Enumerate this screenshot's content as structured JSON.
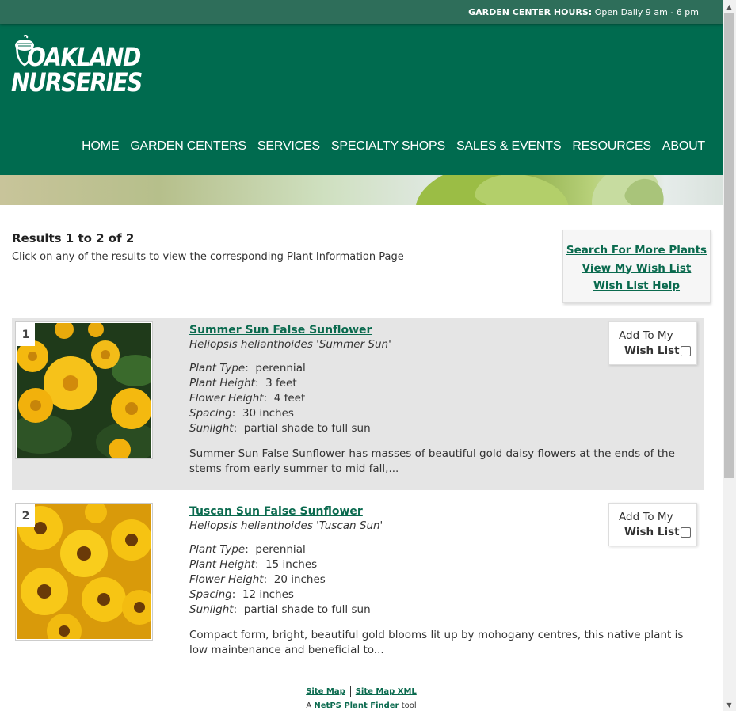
{
  "topbar": {
    "hours_label": "GARDEN CENTER HOURS:",
    "hours_value": "Open Daily 9 am - 6 pm"
  },
  "logo": {
    "line1": "OAKLAND",
    "line2": "NURSERIES"
  },
  "nav": [
    "HOME",
    "GARDEN CENTERS",
    "SERVICES",
    "SPECIALTY SHOPS",
    "SALES & EVENTS",
    "RESOURCES",
    "ABOUT"
  ],
  "results": {
    "title": "Results 1 to 2 of 2",
    "subtitle": "Click on any of the results to view the corresponding Plant Information Page"
  },
  "sidebox": {
    "links": [
      "Search For More Plants",
      "View My Wish List",
      "Wish List Help"
    ]
  },
  "items": [
    {
      "number": "1",
      "name": "Summer Sun False Sunflower",
      "latin": "Heliopsis helianthoides 'Summer Sun'",
      "plant_type_label": "Plant Type",
      "plant_type": "perennial",
      "plant_height_label": "Plant Height",
      "plant_height": "3 feet",
      "flower_height_label": "Flower Height",
      "flower_height": "4 feet",
      "spacing_label": "Spacing",
      "spacing": "30 inches",
      "sunlight_label": "Sunlight",
      "sunlight": "partial shade to full sun",
      "description": "Summer Sun False Sunflower has masses of beautiful gold daisy flowers at the ends of the stems from early summer to mid fall,...",
      "wish_line1": "Add To My",
      "wish_line2": "Wish List"
    },
    {
      "number": "2",
      "name": "Tuscan Sun False Sunflower",
      "latin": "Heliopsis helianthoides 'Tuscan Sun'",
      "plant_type_label": "Plant Type",
      "plant_type": "perennial",
      "plant_height_label": "Plant Height",
      "plant_height": "15 inches",
      "flower_height_label": "Flower Height",
      "flower_height": "20 inches",
      "spacing_label": "Spacing",
      "spacing": "12 inches",
      "sunlight_label": "Sunlight",
      "sunlight": "partial shade to full sun",
      "description": "Compact form, bright, beautiful gold blooms lit up by mohogany centres, this native plant is low maintenance and beneficial to...",
      "wish_line1": "Add To My",
      "wish_line2": "Wish List"
    }
  ],
  "footer": {
    "site_map": "Site Map",
    "site_map_xml": "Site Map XML",
    "line2_prefix": "A",
    "line2_link": "NetPS Plant Finder",
    "line2_suffix": "tool"
  },
  "colors": {
    "header_green": "#006b4f",
    "topbar_green": "#2e6e5a",
    "link_green": "#0a6a4e",
    "row_highlight": "#e5e5e5"
  }
}
